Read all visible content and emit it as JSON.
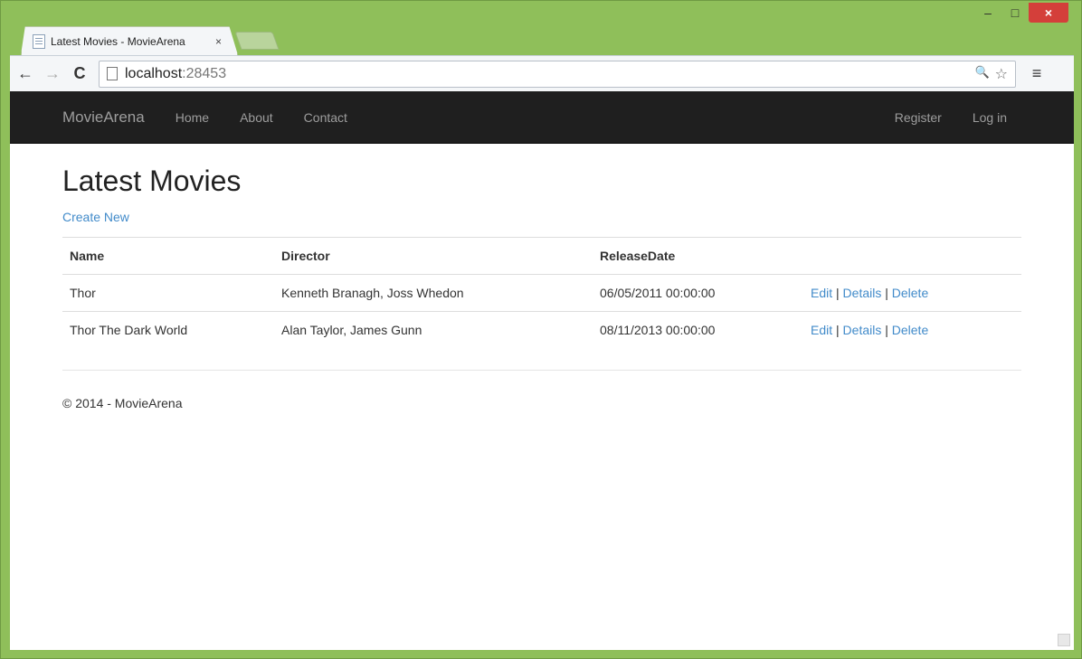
{
  "browser": {
    "tab_title": "Latest Movies - MovieArena",
    "tab_close": "×",
    "url_host": "localhost",
    "url_port": ":28453",
    "back_icon": "←",
    "forward_icon": "→",
    "reload_icon": "C",
    "zoom_icon": "🔍",
    "star_icon": "☆",
    "menu_icon": "≡",
    "min_icon": "–",
    "max_icon": "□",
    "close_icon": "×"
  },
  "navbar": {
    "brand": "MovieArena",
    "links": [
      "Home",
      "About",
      "Contact"
    ],
    "right_links": [
      "Register",
      "Log in"
    ]
  },
  "page": {
    "title": "Latest Movies",
    "create_link": "Create New",
    "table": {
      "headers": [
        "Name",
        "Director",
        "ReleaseDate"
      ],
      "rows": [
        {
          "name": "Thor",
          "director": "Kenneth Branagh, Joss Whedon",
          "release_date": "06/05/2011 00:00:00"
        },
        {
          "name": "Thor The Dark World",
          "director": "Alan Taylor, James Gunn",
          "release_date": "08/11/2013 00:00:00"
        }
      ],
      "actions": {
        "edit": "Edit",
        "details": "Details",
        "delete": "Delete",
        "separator": "|"
      }
    },
    "footer": "© 2014 - MovieArena"
  },
  "colors": {
    "window_frame": "#8fbf5a",
    "navbar_bg": "#1f1f1f",
    "link": "#428bca",
    "close_button": "#d43f3a"
  }
}
